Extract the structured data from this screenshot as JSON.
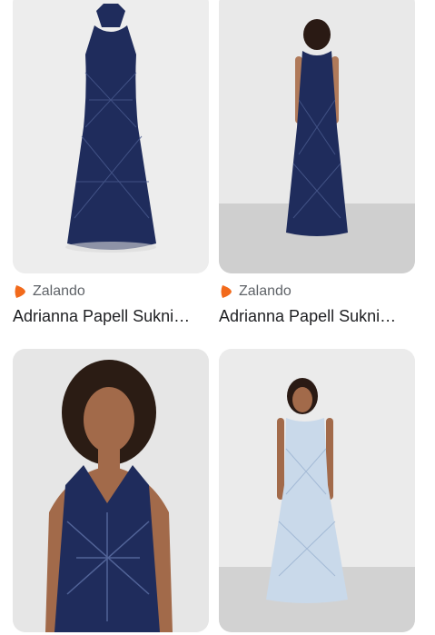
{
  "results": [
    {
      "source": "Zalando",
      "title": "Adrianna Papell Sukni…",
      "image": "navy beaded halter gown, product shot"
    },
    {
      "source": "Zalando",
      "title": "Adrianna Papell Sukni…",
      "image": "model wearing navy beaded gown, back view"
    },
    {
      "source": "",
      "title": "",
      "image": "model wearing navy beaded halter dress, close-up"
    },
    {
      "source": "",
      "title": "",
      "image": "model wearing light blue beaded gown"
    }
  ],
  "colors": {
    "brand_logo": "#f26a1b",
    "navy": "#1f2c5c",
    "light_blue": "#c9d9ea"
  },
  "icons": {
    "source_logo": "zalando-logo-icon"
  }
}
